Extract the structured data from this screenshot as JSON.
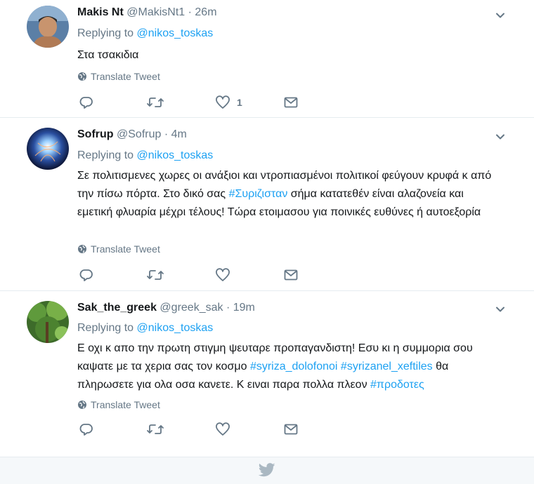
{
  "tweets": [
    {
      "name": "Makis Nt",
      "handle": "@MakisNt1",
      "dot": "·",
      "time": "26m",
      "reply_prefix": "Replying to",
      "reply_to": "@nikos_toskas",
      "text": [
        {
          "t": "Στα τσακιδια",
          "tag": false
        }
      ],
      "translate": "Translate Tweet",
      "likes": "1"
    },
    {
      "name": "Sofrup",
      "handle": "@Sofrup",
      "dot": "·",
      "time": "4m",
      "reply_prefix": "Replying to",
      "reply_to": "@nikos_toskas",
      "text": [
        {
          "t": "Σε πολιτισμενες χωρες οι ανάξιοι και ντροπιασμένοι πολιτικοί φεύγουν κρυφά κ από την πίσω πόρτα. Στο δικό σας ",
          "tag": false
        },
        {
          "t": "#Συριζισταν",
          "tag": true
        },
        {
          "t": " σήμα κατατεθέν είναι αλαζονεία και εμετική φλυαρία μέχρι τέλους! Τώρα ετοιμασου για ποινικές ευθύνες ή αυτοεξορία",
          "tag": false
        }
      ],
      "translate": "Translate Tweet",
      "likes": ""
    },
    {
      "name": "Sak_the_greek",
      "handle": "@greek_sak",
      "dot": "·",
      "time": "19m",
      "reply_prefix": "Replying to",
      "reply_to": "@nikos_toskas",
      "text": [
        {
          "t": "Ε οχι κ απο την πρωτη στιγμη ψευταρε προπαγανδιστη! Εσυ κι η συμμορια σου καψατε με τα χερια σας τον κοσμο ",
          "tag": false
        },
        {
          "t": "#syriza_dolofonoi",
          "tag": true
        },
        {
          "t": " ",
          "tag": false
        },
        {
          "t": "#syrizanel_xeftiles",
          "tag": true
        },
        {
          "t": " θα πληρωσετε για ολα οσα κανετε. Κ ειναι παρα πολλα πλεον ",
          "tag": false
        },
        {
          "t": "#προδοτες",
          "tag": true
        }
      ],
      "translate": "Translate Tweet",
      "likes": ""
    }
  ],
  "icons": {
    "reply": "reply-icon",
    "retweet": "retweet-icon",
    "like": "heart-icon",
    "dm": "envelope-icon",
    "caret": "chevron-down-icon",
    "globe": "globe-icon",
    "footer": "twitter-bird-icon"
  },
  "colors": {
    "link": "#1da1f2",
    "muted": "#657786",
    "text": "#14171a",
    "divider": "#e6ecf0",
    "footer_bg": "#f5f8fa",
    "bird": "#aab8c2"
  }
}
